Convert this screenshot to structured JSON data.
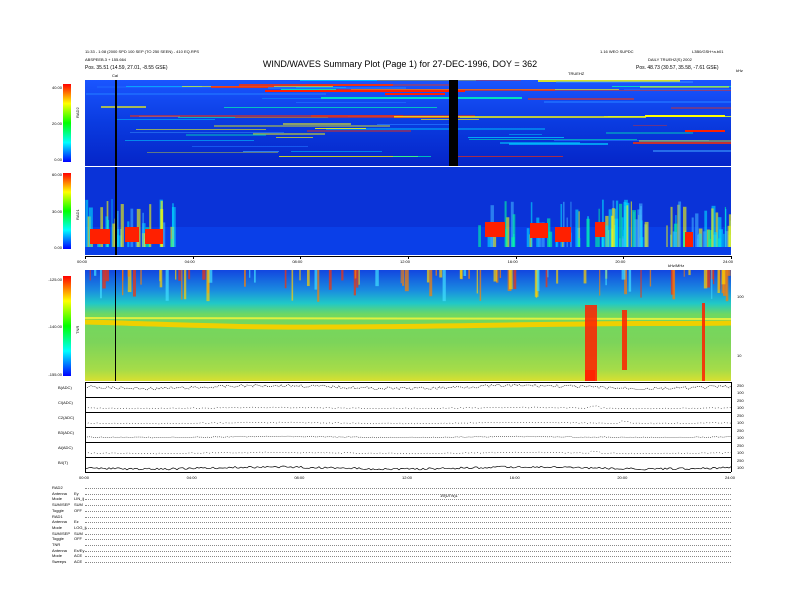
{
  "title": "WIND/WAVES Summary Plot (Page 1) for 27-DEC-1996, DOY = 362",
  "header": {
    "left_line1": "11:33 - 1:08 (2000 SPD 100 SEP (TO 250 SEEN) - 410 EQ.RPS",
    "left_line2": "ABSPEEB.3 + 155.664",
    "left_line3": "Pos.   35.51 (14.59, 27.01, -8.55 GSE)",
    "left_marker": "Cal",
    "right_line1": "1.16 WEO SUPDC",
    "right_line1b": "L3B0/GSH+a.b01",
    "right_line2": "DAILY  TRUEHZ(S) 2002",
    "right_line3": "Pos.   48.73 (30.57, 35.58, -7.61 GSE)",
    "right_marker": "TRUEHZ",
    "right_unit": "kHz"
  },
  "rad2": {
    "label": "RAD2",
    "ticks": [
      "40.00",
      "20.00",
      "0.00"
    ]
  },
  "rad1": {
    "label": "RAD1",
    "ticks": [
      "60.00",
      "30.00",
      "0.00"
    ]
  },
  "tnr": {
    "label": "TNR",
    "ticks": [
      "-125.00",
      "-140.00",
      "-155.00"
    ],
    "right_ticks": [
      "100",
      "10"
    ]
  },
  "time_labels_top": [
    "00:00",
    "04:00",
    "08:00",
    "12:00",
    "16:00",
    "20:00",
    "24:00"
  ],
  "time_labels_top_right": "kHz/MHz",
  "time_labels_bottom": [
    "00:00",
    "04:00",
    "08:00",
    "12:00",
    "16:00",
    "20:00",
    "24:00"
  ],
  "bottom_center_label": "19(UT/s)1",
  "line_panels": [
    {
      "label": "B(ADC)",
      "r1": "250",
      "r2": "100"
    },
    {
      "label": "Cl(ADC)",
      "r1": "250",
      "r2": "100"
    },
    {
      "label": "C2(ADC)",
      "r1": "250",
      "r2": "100"
    },
    {
      "label": "B3(ADC)",
      "r1": "250",
      "r2": "100"
    },
    {
      "label": "Al(ADC)",
      "r1": "250",
      "r2": "100"
    },
    {
      "label": "B4(T)",
      "r1": "250",
      "r2": "100"
    }
  ],
  "footer_rows": [
    {
      "label": "RAD2",
      "value": ""
    },
    {
      "label": "Antenna",
      "value": "Ey"
    },
    {
      "label": "Mode",
      "value": "LIN_ij"
    },
    {
      "label": "SUM/SEP",
      "value": "SUM"
    },
    {
      "label": "Toggle",
      "value": "OFF"
    },
    {
      "label": "RAD1",
      "value": ""
    },
    {
      "label": "Antenna",
      "value": "Ez"
    },
    {
      "label": "Mode",
      "value": "LOG_ij"
    },
    {
      "label": "SUM/SEP",
      "value": "SUM"
    },
    {
      "label": "Toggle",
      "value": "OFF"
    },
    {
      "label": "TNR",
      "value": ""
    },
    {
      "label": "Antenna",
      "value": "Ex/Ey"
    },
    {
      "label": "Mode",
      "value": "ACE"
    },
    {
      "label": "Sweeps",
      "value": "ACE"
    }
  ],
  "colors": {
    "background": "#0a2fd6",
    "burst": "#ff2000",
    "tnr_base": "#66d060",
    "tnr_band": "#f0d000",
    "colorbar": [
      "#ff0000",
      "#ffff00",
      "#00ff00",
      "#00ffff",
      "#0000ff"
    ]
  },
  "chart_data": [
    {
      "type": "heatmap",
      "label": "RAD2",
      "ylim": [
        0,
        40
      ],
      "x_range_ut_hours": [
        0,
        24
      ],
      "colorbar_range": [
        0,
        40
      ],
      "notes": "data gap (black) near 13:00 UT; calibration marker near 01:00 UT"
    },
    {
      "type": "heatmap",
      "label": "RAD1",
      "ylim": [
        0,
        60
      ],
      "x_range_ut_hours": [
        0,
        24
      ],
      "colorbar_range": [
        0,
        60
      ]
    },
    {
      "type": "heatmap",
      "label": "TNR",
      "colorbar_range": [
        -155,
        -125
      ],
      "x_range_ut_hours": [
        0,
        24
      ]
    }
  ]
}
